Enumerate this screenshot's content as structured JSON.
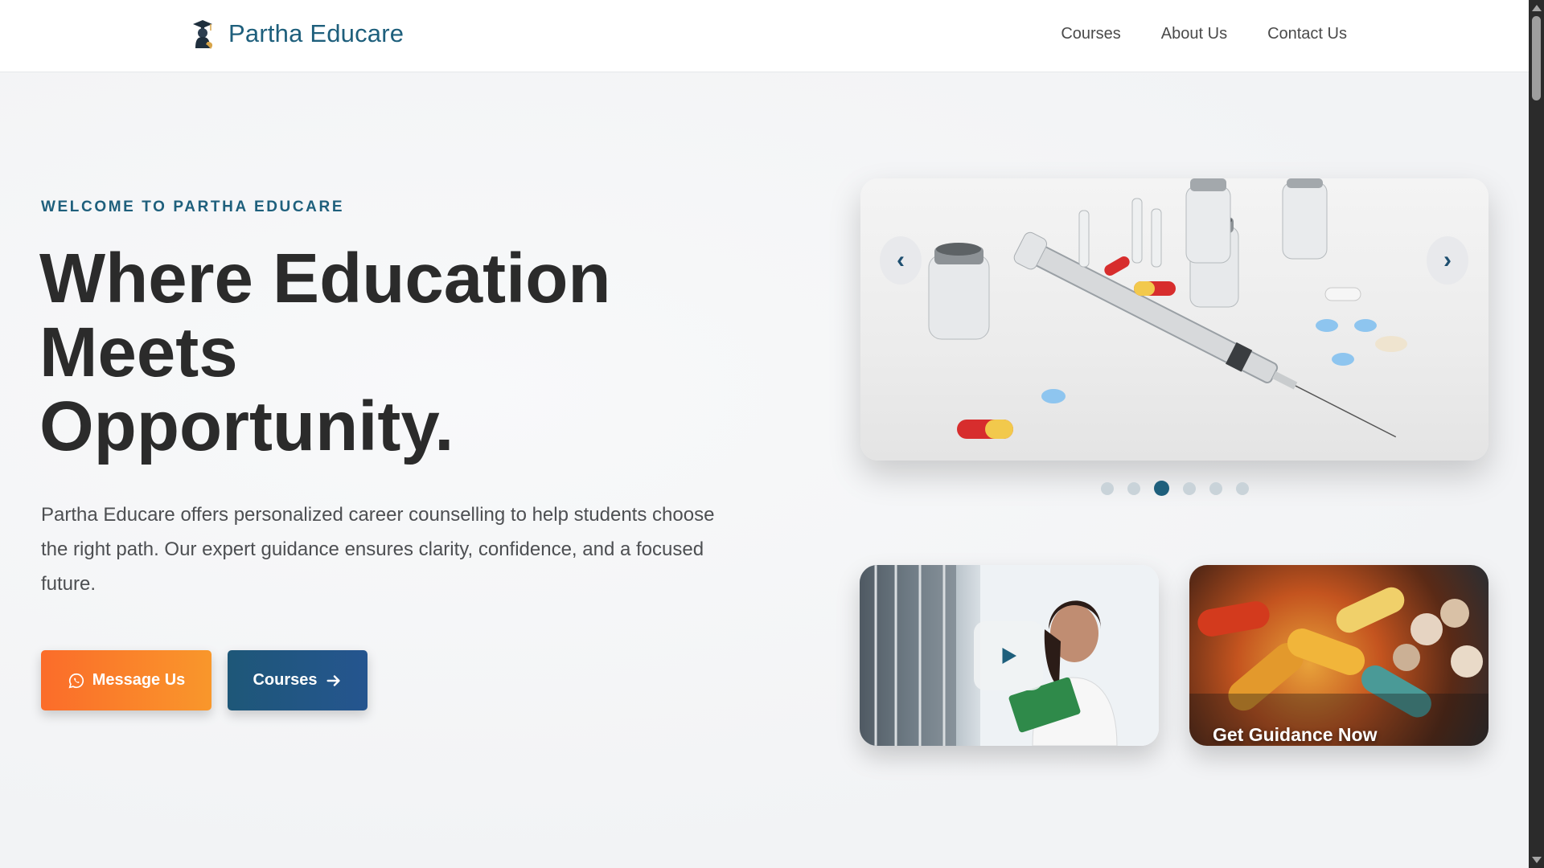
{
  "navbar": {
    "brand_name": "Partha Educare",
    "links": [
      {
        "label": "Courses"
      },
      {
        "label": "About Us"
      },
      {
        "label": "Contact Us"
      }
    ]
  },
  "hero": {
    "eyebrow": "WELCOME TO PARTHA EDUCARE",
    "headline_line1": "Where Education",
    "headline_line2": "Meets",
    "headline_line3": "Opportunity.",
    "description": "Partha Educare offers personalized career counselling to help students choose the right path. Our expert guidance ensures clarity, confidence, and a focused future.",
    "buttons": {
      "message_label": "Message Us",
      "courses_label": "Courses"
    }
  },
  "slider": {
    "prev_arrow": "‹",
    "next_arrow": "›",
    "dot_count": 6,
    "active_dot": 3
  },
  "cards": {
    "guidance_label": "Get Guidance Now"
  },
  "colors": {
    "brand": "#1e5f7c",
    "message_gradient": [
      "#fb6c2a",
      "#f9972b"
    ],
    "courses_gradient": [
      "#1e5778",
      "#25558f"
    ],
    "heading": "#2b2b2b"
  },
  "icons": {
    "logo": "graduation-logo-icon",
    "message": "whatsapp-icon",
    "courses": "arrow-right-icon",
    "video": "play-icon"
  }
}
